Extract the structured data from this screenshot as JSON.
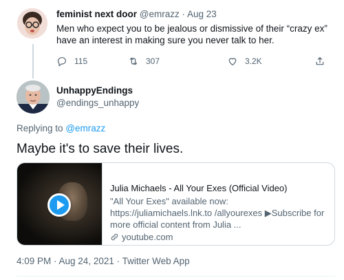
{
  "parent_tweet": {
    "display_name": "feminist next door",
    "handle": "@emrazz",
    "separator": "·",
    "date": "Aug 23",
    "text": "Men who expect you to be jealous or dismissive of their “crazy ex” have an interest in making sure you never talk to her.",
    "actions": {
      "reply_count": "115",
      "retweet_count": "307",
      "like_count": "3.2K"
    }
  },
  "reply_tweet": {
    "display_name": "UnhappyEndings",
    "handle": "@endings_unhappy",
    "replying_to_label": "Replying to",
    "replying_to_handle": "@emrazz",
    "text": "Maybe it's to save their lives.",
    "card": {
      "title": "Julia Michaels - All Your Exes (Official Video)",
      "description": "\"All Your Exes\" available now: https://juliamichaels.lnk.to /allyourexes ▶Subscribe for more official content from Julia ...",
      "domain": "youtube.com"
    },
    "timestamp": "4:09 PM · Aug 24, 2021 · Twitter Web App"
  },
  "colors": {
    "link": "#1d9bf0",
    "muted": "#536471",
    "text": "#0f1419",
    "border": "#cfd9de"
  },
  "icons": [
    "reply-icon",
    "retweet-icon",
    "like-icon",
    "share-icon",
    "link-icon",
    "play-icon"
  ]
}
